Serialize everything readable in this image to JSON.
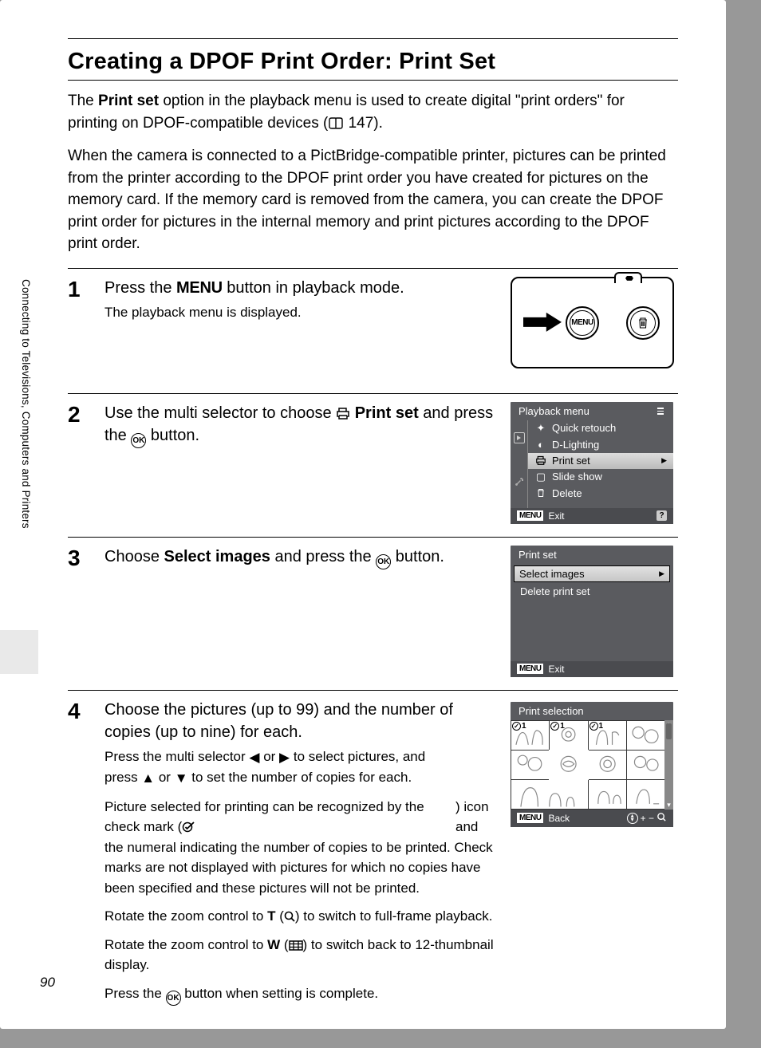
{
  "page_number": "90",
  "sidebar_chapter": "Connecting to Televisions, Computers and Printers",
  "title": "Creating a DPOF Print Order: Print Set",
  "intro": {
    "p1a": "The ",
    "p1b": "Print set",
    "p1c": " option in the playback menu is used to create digital \"print orders\" for printing on DPOF-compatible devices (",
    "p1_ref": " 147).",
    "p2": "When the camera is connected to a PictBridge-compatible printer, pictures can be printed from the printer according to the DPOF print order you have created for pictures on the memory card. If the memory card is removed from the camera, you can create the DPOF print order for pictures in the internal memory and print pictures according to the DPOF print order."
  },
  "steps": {
    "s1": {
      "num": "1",
      "title_a": "Press the ",
      "title_menu": "MENU",
      "title_b": " button in playback mode.",
      "sub": "The playback menu is displayed.",
      "camera_menu_label": "MENU"
    },
    "s2": {
      "num": "2",
      "title_a": "Use the multi selector to choose ",
      "title_bold": "Print set",
      "title_b": " and press the ",
      "title_c": " button.",
      "ok": "OK",
      "lcd": {
        "header": "Playback menu",
        "items": [
          {
            "label": "Quick retouch"
          },
          {
            "label": "D-Lighting"
          },
          {
            "label": "Print set",
            "selected": true
          },
          {
            "label": "Slide show"
          },
          {
            "label": "Delete"
          }
        ],
        "footer_menu": "MENU",
        "footer": "Exit"
      }
    },
    "s3": {
      "num": "3",
      "title_a": "Choose ",
      "title_bold": "Select images",
      "title_b": " and press the ",
      "title_c": " button.",
      "ok": "OK",
      "lcd": {
        "header": "Print set",
        "items": [
          {
            "label": "Select images",
            "selected": true
          },
          {
            "label": "Delete print set"
          }
        ],
        "footer_menu": "MENU",
        "footer": "Exit"
      }
    },
    "s4": {
      "num": "4",
      "title": "Choose the pictures (up to 99) and the number of copies (up to nine) for each.",
      "p1a": "Press the multi selector ",
      "p1b": " or ",
      "p1c": " to select pictures, and press ",
      "p1d": " or ",
      "p1e": " to set the number of copies for each.",
      "p2a": "Picture selected for printing can be recognized by the check mark (",
      "p2b": ") icon and the numeral indicating the number of copies to be printed. Check marks are not displayed with pictures for which no copies have been specified and these pictures will not be printed.",
      "p3a": "Rotate the zoom control to ",
      "p3T": "T",
      "p3b": " (",
      "p3c": ") to switch to full-frame playback.",
      "p4a": "Rotate the zoom control to ",
      "p4W": "W",
      "p4b": " (",
      "p4c": ") to switch back to 12-thumbnail display.",
      "p5a": "Press the ",
      "p5b": " button when setting is complete.",
      "ok": "OK",
      "lcd": {
        "header": "Print selection",
        "footer_menu": "MENU",
        "footer": "Back",
        "thumbs": [
          {
            "badge": "1"
          },
          {
            "badge": "1"
          },
          {
            "badge": "1"
          },
          {},
          {},
          {},
          {},
          {},
          {
            "big": true
          },
          {},
          {}
        ]
      }
    }
  }
}
